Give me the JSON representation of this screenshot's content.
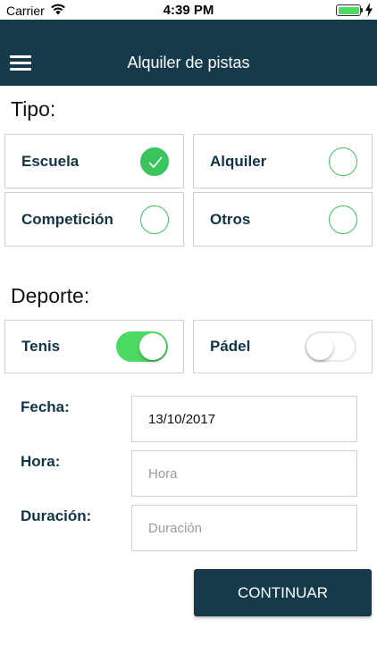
{
  "status_bar": {
    "carrier": "Carrier",
    "time": "4:39 PM",
    "wifi_icon": "wifi-icon",
    "battery_icon": "battery-icon",
    "battery_color": "#4cd964",
    "charging_icon": "bolt-icon"
  },
  "header": {
    "title": "Alquiler de pistas",
    "menu_icon": "hamburger-menu-icon",
    "background": "#153a4c"
  },
  "tipo": {
    "title": "Tipo:",
    "options": [
      {
        "label": "Escuela",
        "checked": true
      },
      {
        "label": "Alquiler",
        "checked": false
      },
      {
        "label": "Competición",
        "checked": false
      },
      {
        "label": "Otros",
        "checked": false
      }
    ],
    "accent": "#3ac45e"
  },
  "deporte": {
    "title": "Deporte:",
    "options": [
      {
        "label": "Tenis",
        "on": true
      },
      {
        "label": "Pádel",
        "on": false
      }
    ],
    "toggle_color": "#4cd964"
  },
  "form": {
    "fecha": {
      "label": "Fecha:",
      "value": "13/10/2017",
      "placeholder": ""
    },
    "hora": {
      "label": "Hora:",
      "value": "",
      "placeholder": "Hora"
    },
    "duracion": {
      "label": "Duración:",
      "value": "",
      "placeholder": "Duración"
    }
  },
  "actions": {
    "continue_label": "CONTINUAR"
  }
}
